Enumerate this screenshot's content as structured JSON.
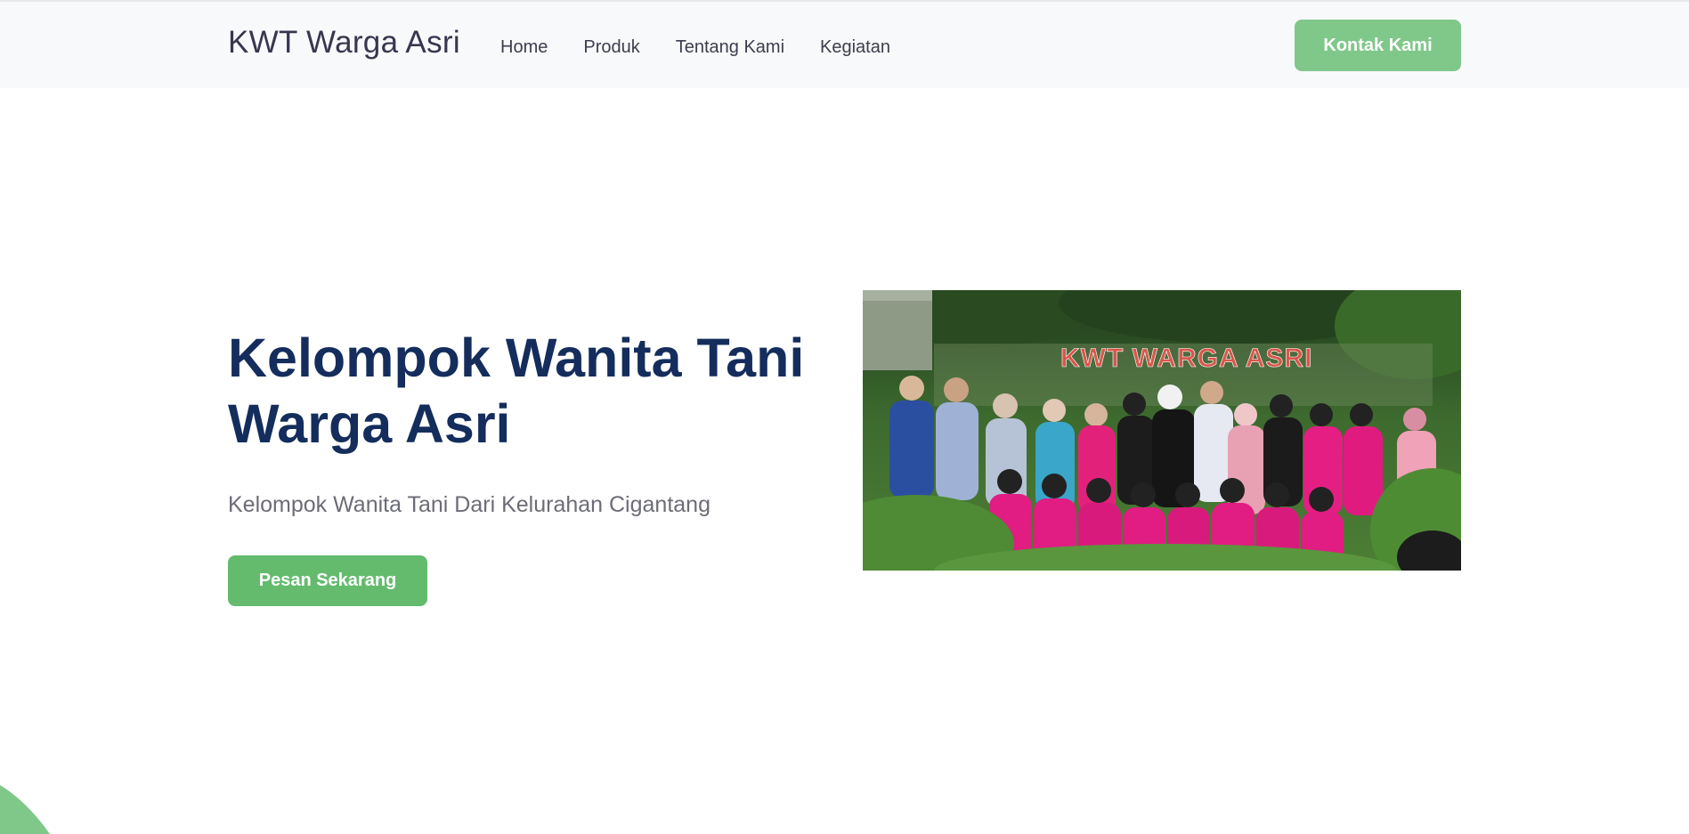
{
  "header": {
    "brand": "KWT Warga Asri",
    "nav": [
      "Home",
      "Produk",
      "Tentang Kami",
      "Kegiatan"
    ],
    "contact_label": "Kontak Kami"
  },
  "hero": {
    "title": "Kelompok Wanita Tani Warga Asri",
    "subtitle": "Kelompok Wanita Tani Dari Kelurahan Cigantang",
    "cta_label": "Pesan Sekarang",
    "photo": {
      "sign_text": "KWT WARGA ASRI"
    }
  },
  "colors": {
    "accent": "#64bb6e",
    "accent_light": "#7fc88a",
    "heading": "#142d5c",
    "navbar_bg": "#f8f9fb"
  }
}
